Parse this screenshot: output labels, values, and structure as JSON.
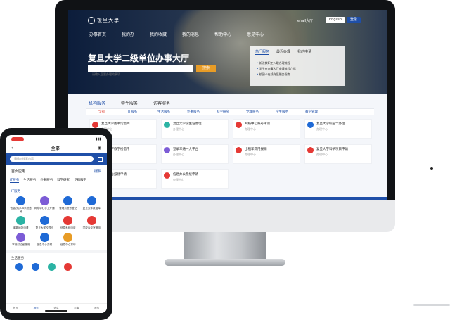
{
  "desktop": {
    "logo": "復旦大學",
    "nav_user": "ehall大厅",
    "nav_buttons": [
      "English",
      "登录"
    ],
    "menu": [
      "办事首页",
      "我的办",
      "我的收藏",
      "我的消息",
      "帮助中心",
      "意见中心"
    ],
    "hero_title": "复旦大学二级单位办事大厅",
    "search_placeholder": "请输入您要办理的事项",
    "search_button": "搜索",
    "notice_tabs": [
      "热门服务",
      "最近办理",
      "我的申请"
    ],
    "notice_items": [
      "新进教职工入职办理流程",
      "学生在办事大厅申请流程介绍",
      "校园卡在线充值服务指南"
    ],
    "tabs": [
      "机构服务",
      "学生服务",
      "访客服务"
    ],
    "categories": [
      "全部",
      "IT服务",
      "生活服务",
      "外事服务",
      "科学研究",
      "党群服务",
      "学生服务",
      "教学管理"
    ],
    "cards": [
      {
        "title": "复旦大学图书馆借阅",
        "sub": "办理中心",
        "color": "#e53935"
      },
      {
        "title": "复旦大学学生证办理",
        "sub": "办理中心",
        "color": "#2bb3a4"
      },
      {
        "title": "网络中心账号申请",
        "sub": "办理中心",
        "color": "#e53935"
      },
      {
        "title": "复旦大学校园卡办理",
        "sub": "办理中心",
        "color": "#1f6ad6"
      },
      {
        "title": "复旦大学教学楼借用",
        "sub": "办理中心",
        "color": "#1f6ad6"
      },
      {
        "title": "登录三通一大平台",
        "sub": "办理中心",
        "color": "#7c5cd6"
      },
      {
        "title": "出租车费用报销",
        "sub": "办理中心",
        "color": "#e53935"
      },
      {
        "title": "复旦大学科研项目申请",
        "sub": "办理中心",
        "color": "#e53935"
      },
      {
        "title": "学生宿舍报修申请",
        "sub": "办理中心",
        "color": "#e53935"
      },
      {
        "title": "信息办公系统申请",
        "sub": "办理中心",
        "color": "#e53935"
      }
    ]
  },
  "mobile": {
    "title": "全部",
    "search_placeholder": "请输入搜索内容",
    "section": "首页应用",
    "section_more": "编辑",
    "tabs": [
      "IT服务",
      "生活服务",
      "外事服务",
      "科学研究",
      "党群服务"
    ],
    "sub_title": "IT服务",
    "items": [
      {
        "label": "信息办公OA系统账号",
        "color": "#1f6ad6"
      },
      {
        "label": "网络中心手工开通",
        "color": "#7c5cd6"
      },
      {
        "label": "管理员账号登记",
        "color": "#1f6ad6"
      },
      {
        "label": "复旦大学数据库",
        "color": "#1f6ad6"
      },
      {
        "label": "邮箱地址申请",
        "color": "#2bb3a4"
      },
      {
        "label": "复旦大学校园卡",
        "color": "#1f6ad6"
      },
      {
        "label": "信息系统申请",
        "color": "#e53935"
      },
      {
        "label": "学校会议室借用",
        "color": "#e53935"
      },
      {
        "label": "学院讨论室借用",
        "color": "#7c5cd6"
      },
      {
        "label": "信息中心办理",
        "color": "#1f6ad6"
      },
      {
        "label": "信息中心打印",
        "color": "#e89c26"
      }
    ],
    "sub_title2": "生活服务",
    "footer": [
      "首页",
      "服务",
      "消息",
      "办事",
      "我的"
    ]
  }
}
